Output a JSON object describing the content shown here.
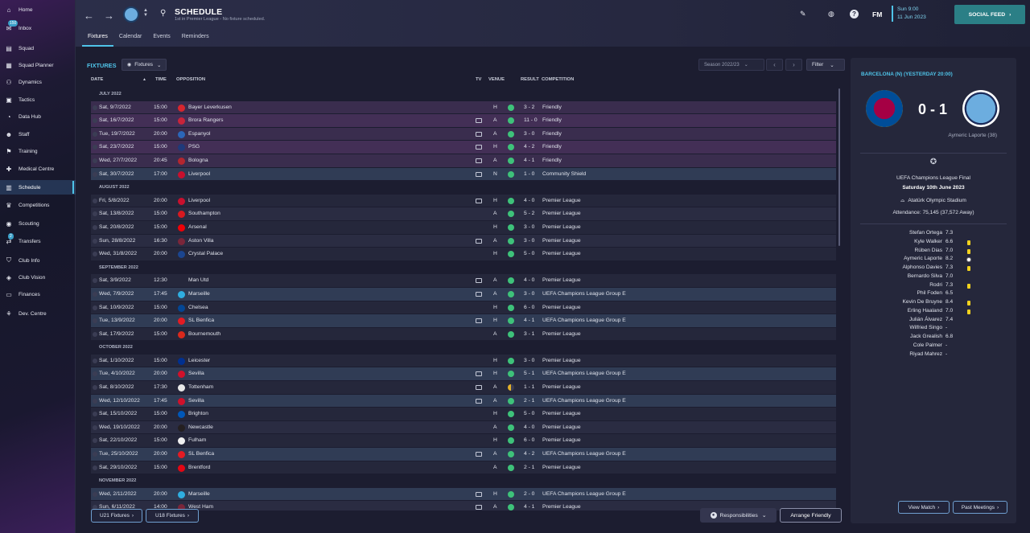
{
  "sidebar": {
    "items": [
      {
        "label": "Home",
        "icon": "⌂"
      },
      {
        "label": "Inbox",
        "icon": "✉",
        "badge": "150"
      },
      {
        "label": "Squad",
        "icon": "▤"
      },
      {
        "label": "Squad Planner",
        "icon": "▦"
      },
      {
        "label": "Dynamics",
        "icon": "⚇"
      },
      {
        "label": "Tactics",
        "icon": "▣"
      },
      {
        "label": "Data Hub",
        "icon": "◔"
      },
      {
        "label": "Staff",
        "icon": "☻"
      },
      {
        "label": "Training",
        "icon": "⚑"
      },
      {
        "label": "Medical Centre",
        "icon": "✚"
      },
      {
        "label": "Schedule",
        "icon": "▥"
      },
      {
        "label": "Competitions",
        "icon": "♛"
      },
      {
        "label": "Scouting",
        "icon": "◉"
      },
      {
        "label": "Transfers",
        "icon": "⇄",
        "badge": "2"
      },
      {
        "label": "Club Info",
        "icon": "⛉"
      },
      {
        "label": "Club Vision",
        "icon": "◈"
      },
      {
        "label": "Finances",
        "icon": "▭"
      },
      {
        "label": "Dev. Centre",
        "icon": "⚘"
      }
    ],
    "active_index": 10
  },
  "header": {
    "title": "SCHEDULE",
    "subtitle": "1st in Premier League - No fixture scheduled.",
    "tabs": [
      "Fixtures",
      "Calendar",
      "Events",
      "Reminders"
    ],
    "fm_logo": "FM",
    "date_line1": "Sun 9:00",
    "date_line2": "11 Jun 2023",
    "social_feed": "SOCIAL FEED"
  },
  "fixtures": {
    "section_title": "FIXTURES",
    "view_dropdown": "Fixtures",
    "season": "Season 2022/23",
    "filter": "Filter",
    "columns": {
      "date": "DATE",
      "time": "TIME",
      "opposition": "OPPOSITION",
      "tv": "TV",
      "venue": "VENUE",
      "result": "RESULT",
      "competition": "COMPETITION"
    },
    "groups": [
      {
        "month": "JULY 2022",
        "rows": [
          {
            "date": "Sat, 9/7/2022",
            "time": "15:00",
            "opp": "Bayer Leverkusen",
            "crest": "#d7262e",
            "tv": false,
            "venue": "H",
            "result": "w",
            "score": "3 - 2",
            "comp": "Friendly",
            "hl": "purple"
          },
          {
            "date": "Sat, 16/7/2022",
            "time": "15:00",
            "opp": "Brora Rangers",
            "crest": "#c8243a",
            "tv": true,
            "venue": "A",
            "result": "w",
            "score": "11 - 0",
            "comp": "Friendly",
            "hl": "purple"
          },
          {
            "date": "Tue, 19/7/2022",
            "time": "20:00",
            "opp": "Espanyol",
            "crest": "#2b66b8",
            "tv": true,
            "venue": "A",
            "result": "w",
            "score": "3 - 0",
            "comp": "Friendly",
            "hl": "purple"
          },
          {
            "date": "Sat, 23/7/2022",
            "time": "15:00",
            "opp": "PSG",
            "crest": "#1f3a7a",
            "tv": true,
            "venue": "H",
            "result": "w",
            "score": "4 - 2",
            "comp": "Friendly",
            "hl": "purple"
          },
          {
            "date": "Wed, 27/7/2022",
            "time": "20:45",
            "opp": "Bologna",
            "crest": "#b3262f",
            "tv": true,
            "venue": "A",
            "result": "w",
            "score": "4 - 1",
            "comp": "Friendly",
            "hl": "purple"
          },
          {
            "date": "Sat, 30/7/2022",
            "time": "17:00",
            "opp": "Liverpool",
            "crest": "#c8102e",
            "tv": true,
            "venue": "N",
            "result": "w",
            "score": "1 - 0",
            "comp": "Community Shield",
            "hl": "blue"
          }
        ]
      },
      {
        "month": "AUGUST 2022",
        "rows": [
          {
            "date": "Fri, 5/8/2022",
            "time": "20:00",
            "opp": "Liverpool",
            "crest": "#c8102e",
            "tv": true,
            "venue": "H",
            "result": "w",
            "score": "4 - 0",
            "comp": "Premier League"
          },
          {
            "date": "Sat, 13/8/2022",
            "time": "15:00",
            "opp": "Southampton",
            "crest": "#d71920",
            "tv": false,
            "venue": "A",
            "result": "w",
            "score": "5 - 2",
            "comp": "Premier League"
          },
          {
            "date": "Sat, 20/8/2022",
            "time": "15:00",
            "opp": "Arsenal",
            "crest": "#ef0107",
            "tv": false,
            "venue": "H",
            "result": "w",
            "score": "3 - 0",
            "comp": "Premier League"
          },
          {
            "date": "Sun, 28/8/2022",
            "time": "16:30",
            "opp": "Aston Villa",
            "crest": "#7a263a",
            "tv": true,
            "venue": "A",
            "result": "w",
            "score": "3 - 0",
            "comp": "Premier League"
          },
          {
            "date": "Wed, 31/8/2022",
            "time": "20:00",
            "opp": "Crystal Palace",
            "crest": "#1b458f",
            "tv": false,
            "venue": "H",
            "result": "w",
            "score": "5 - 0",
            "comp": "Premier League"
          }
        ]
      },
      {
        "month": "SEPTEMBER 2022",
        "rows": [
          {
            "date": "Sat, 3/9/2022",
            "time": "12:30",
            "opp": "Man Utd",
            "crest": "",
            "tv": true,
            "venue": "A",
            "result": "w",
            "score": "4 - 0",
            "comp": "Premier League"
          },
          {
            "date": "Wed, 7/9/2022",
            "time": "17:45",
            "opp": "Marseille",
            "crest": "#2faee0",
            "tv": true,
            "venue": "A",
            "result": "w",
            "score": "3 - 0",
            "comp": "UEFA Champions League Group E",
            "hl": "blue"
          },
          {
            "date": "Sat, 10/9/2022",
            "time": "15:00",
            "opp": "Chelsea",
            "crest": "#034694",
            "tv": false,
            "venue": "H",
            "result": "w",
            "score": "6 - 0",
            "comp": "Premier League"
          },
          {
            "date": "Tue, 13/9/2022",
            "time": "20:00",
            "opp": "SL Benfica",
            "crest": "#e41b23",
            "tv": true,
            "venue": "H",
            "result": "w",
            "score": "4 - 1",
            "comp": "UEFA Champions League Group E",
            "hl": "blue"
          },
          {
            "date": "Sat, 17/9/2022",
            "time": "15:00",
            "opp": "Bournemouth",
            "crest": "#da291c",
            "tv": false,
            "venue": "A",
            "result": "w",
            "score": "3 - 1",
            "comp": "Premier League"
          }
        ]
      },
      {
        "month": "OCTOBER 2022",
        "rows": [
          {
            "date": "Sat, 1/10/2022",
            "time": "15:00",
            "opp": "Leicester",
            "crest": "#003090",
            "tv": false,
            "venue": "H",
            "result": "w",
            "score": "3 - 0",
            "comp": "Premier League"
          },
          {
            "date": "Tue, 4/10/2022",
            "time": "20:00",
            "opp": "Sevilla",
            "crest": "#d0112b",
            "tv": true,
            "venue": "H",
            "result": "w",
            "score": "5 - 1",
            "comp": "UEFA Champions League Group E",
            "hl": "blue"
          },
          {
            "date": "Sat, 8/10/2022",
            "time": "17:30",
            "opp": "Tottenham",
            "crest": "#e8e8e8",
            "tv": true,
            "venue": "A",
            "result": "d",
            "score": "1 - 1",
            "comp": "Premier League"
          },
          {
            "date": "Wed, 12/10/2022",
            "time": "17:45",
            "opp": "Sevilla",
            "crest": "#d0112b",
            "tv": true,
            "venue": "A",
            "result": "w",
            "score": "2 - 1",
            "comp": "UEFA Champions League Group E",
            "hl": "blue"
          },
          {
            "date": "Sat, 15/10/2022",
            "time": "15:00",
            "opp": "Brighton",
            "crest": "#0057b8",
            "tv": false,
            "venue": "H",
            "result": "w",
            "score": "5 - 0",
            "comp": "Premier League"
          },
          {
            "date": "Wed, 19/10/2022",
            "time": "20:00",
            "opp": "Newcastle",
            "crest": "#241f20",
            "tv": false,
            "venue": "A",
            "result": "w",
            "score": "4 - 0",
            "comp": "Premier League"
          },
          {
            "date": "Sat, 22/10/2022",
            "time": "15:00",
            "opp": "Fulham",
            "crest": "#f0f0f0",
            "tv": false,
            "venue": "H",
            "result": "w",
            "score": "6 - 0",
            "comp": "Premier League"
          },
          {
            "date": "Tue, 25/10/2022",
            "time": "20:00",
            "opp": "SL Benfica",
            "crest": "#e41b23",
            "tv": true,
            "venue": "A",
            "result": "w",
            "score": "4 - 2",
            "comp": "UEFA Champions League Group E",
            "hl": "blue"
          },
          {
            "date": "Sat, 29/10/2022",
            "time": "15:00",
            "opp": "Brentford",
            "crest": "#e30613",
            "tv": false,
            "venue": "A",
            "result": "w",
            "score": "2 - 1",
            "comp": "Premier League"
          }
        ]
      },
      {
        "month": "NOVEMBER 2022",
        "rows": [
          {
            "date": "Wed, 2/11/2022",
            "time": "20:00",
            "opp": "Marseille",
            "crest": "#2faee0",
            "tv": true,
            "venue": "H",
            "result": "w",
            "score": "2 - 0",
            "comp": "UEFA Champions League Group E",
            "hl": "blue"
          },
          {
            "date": "Sun, 6/11/2022",
            "time": "14:00",
            "opp": "West Ham",
            "crest": "#7a263a",
            "tv": true,
            "venue": "A",
            "result": "w",
            "score": "4 - 1",
            "comp": "Premier League"
          }
        ]
      }
    ],
    "u21_button": "U21 Fixtures",
    "u18_button": "U18 Fixtures",
    "responsibilities": "Responsibilities",
    "arrange_friendly": "Arrange Friendly"
  },
  "match_panel": {
    "title": "BARCELONA (N) (YESTERDAY 20:00)",
    "home_crest_color": "#a50044",
    "away_crest_color": "#6caddf",
    "score": "0 - 1",
    "scorer": "Aymeric Laporte (38)",
    "competition": "UEFA Champions League Final",
    "date": "Saturday 10th June 2023",
    "stadium": "Atatürk Olympic Stadium",
    "attendance": "Attendance: 75,145 (37,572 Away)",
    "players": [
      {
        "name": "Stefan Ortega",
        "rating": "7.3",
        "mark": ""
      },
      {
        "name": "Kyle Walker",
        "rating": "6.6",
        "mark": "card"
      },
      {
        "name": "Rúben Dias",
        "rating": "7.0",
        "mark": "card"
      },
      {
        "name": "Aymeric Laporte",
        "rating": "8.2",
        "mark": "ball"
      },
      {
        "name": "Alphonso Davies",
        "rating": "7.3",
        "mark": "card"
      },
      {
        "name": "Bernardo Silva",
        "rating": "7.0",
        "mark": ""
      },
      {
        "name": "Rodri",
        "rating": "7.3",
        "mark": "card"
      },
      {
        "name": "Phil Foden",
        "rating": "6.5",
        "mark": ""
      },
      {
        "name": "Kevin De Bruyne",
        "rating": "8.4",
        "mark": "card"
      },
      {
        "name": "Erling Haaland",
        "rating": "7.0",
        "mark": "card"
      },
      {
        "name": "Julián Álvarez",
        "rating": "7.4",
        "mark": ""
      },
      {
        "name": "Wilfried Singo",
        "rating": "-",
        "mark": ""
      },
      {
        "name": "Jack Grealish",
        "rating": "6.8",
        "mark": ""
      },
      {
        "name": "Cole Palmer",
        "rating": "-",
        "mark": ""
      },
      {
        "name": "Riyad Mahrez",
        "rating": "-",
        "mark": ""
      }
    ],
    "view_match": "View Match",
    "past_meetings": "Past Meetings"
  },
  "colors": {
    "accent": "#4fc3e8",
    "win": "#3ec27a",
    "draw": "#e3b12a",
    "social": "#2b7f86"
  }
}
